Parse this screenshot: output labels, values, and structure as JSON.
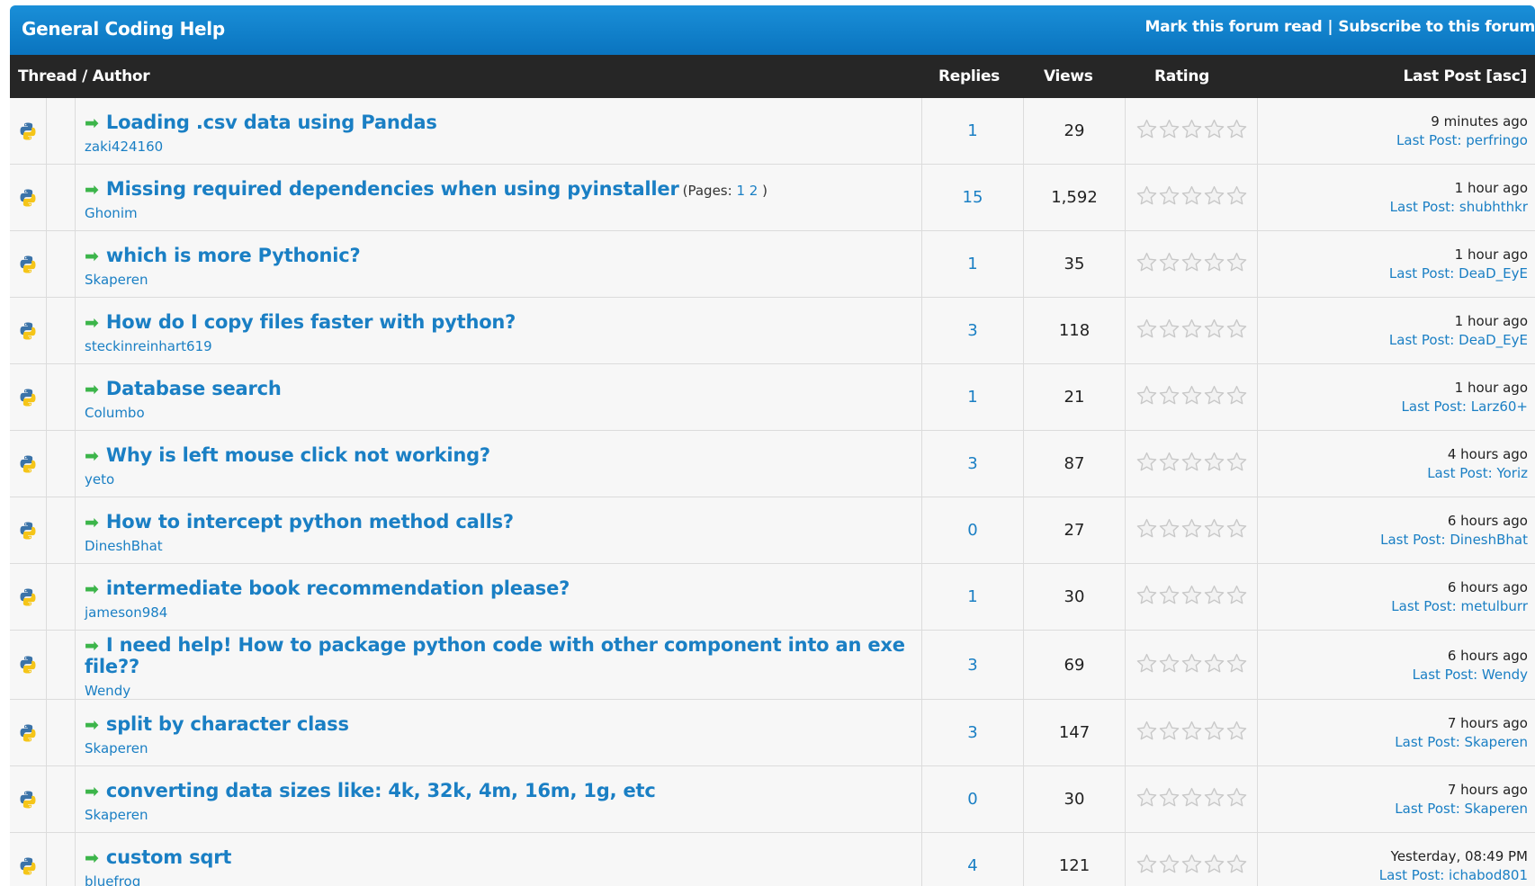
{
  "forum": {
    "title": "General Coding Help",
    "mark_read": "Mark this forum read",
    "separator": "|",
    "subscribe": "Subscribe to this forum"
  },
  "columns": {
    "thread_author": "Thread / Author",
    "replies": "Replies",
    "views": "Views",
    "rating": "Rating",
    "last_post": "Last Post [asc]"
  },
  "labels": {
    "last_post_prefix": "Last Post: ",
    "pages_prefix": "(Pages: ",
    "pages_suffix": " )"
  },
  "colors": {
    "header_blue": "#0f7fc8",
    "column_header": "#262626",
    "link_blue": "#1a7fc4",
    "arrow_green": "#3cb54a"
  },
  "threads": [
    {
      "title": "Loading .csv data using Pandas",
      "author": "zaki424160",
      "replies": "1",
      "views": "29",
      "rating_stars": 0,
      "time": "9 minutes ago",
      "last_user": "perfringo",
      "pages": []
    },
    {
      "title": "Missing required dependencies when using pyinstaller",
      "author": "Ghonim",
      "replies": "15",
      "views": "1,592",
      "rating_stars": 0,
      "time": "1 hour ago",
      "last_user": "shubhthkr",
      "pages": [
        "1",
        "2"
      ]
    },
    {
      "title": "which is more Pythonic?",
      "author": "Skaperen",
      "replies": "1",
      "views": "35",
      "rating_stars": 0,
      "time": "1 hour ago",
      "last_user": "DeaD_EyE",
      "pages": []
    },
    {
      "title": "How do I copy files faster with python?",
      "author": "steckinreinhart619",
      "replies": "3",
      "views": "118",
      "rating_stars": 0,
      "time": "1 hour ago",
      "last_user": "DeaD_EyE",
      "pages": []
    },
    {
      "title": "Database search",
      "author": "Columbo",
      "replies": "1",
      "views": "21",
      "rating_stars": 0,
      "time": "1 hour ago",
      "last_user": "Larz60+",
      "pages": []
    },
    {
      "title": "Why is left mouse click not working?",
      "author": "yeto",
      "replies": "3",
      "views": "87",
      "rating_stars": 0,
      "time": "4 hours ago",
      "last_user": "Yoriz",
      "pages": []
    },
    {
      "title": "How to intercept python method calls?",
      "author": "DineshBhat",
      "replies": "0",
      "views": "27",
      "rating_stars": 0,
      "time": "6 hours ago",
      "last_user": "DineshBhat",
      "pages": []
    },
    {
      "title": "intermediate book recommendation please?",
      "author": "jameson984",
      "replies": "1",
      "views": "30",
      "rating_stars": 0,
      "time": "6 hours ago",
      "last_user": "metulburr",
      "pages": []
    },
    {
      "title": "I need help! How to package python code with other component into an exe file??",
      "author": "Wendy",
      "replies": "3",
      "views": "69",
      "rating_stars": 0,
      "time": "6 hours ago",
      "last_user": "Wendy",
      "pages": []
    },
    {
      "title": "split by character class",
      "author": "Skaperen",
      "replies": "3",
      "views": "147",
      "rating_stars": 0,
      "time": "7 hours ago",
      "last_user": "Skaperen",
      "pages": []
    },
    {
      "title": "converting data sizes like: 4k, 32k, 4m, 16m, 1g, etc",
      "author": "Skaperen",
      "replies": "0",
      "views": "30",
      "rating_stars": 0,
      "time": "7 hours ago",
      "last_user": "Skaperen",
      "pages": []
    },
    {
      "title": "custom sqrt",
      "author": "bluefrog",
      "replies": "4",
      "views": "121",
      "rating_stars": 0,
      "time": "Yesterday, 08:49 PM",
      "last_user": "ichabod801",
      "pages": []
    }
  ]
}
